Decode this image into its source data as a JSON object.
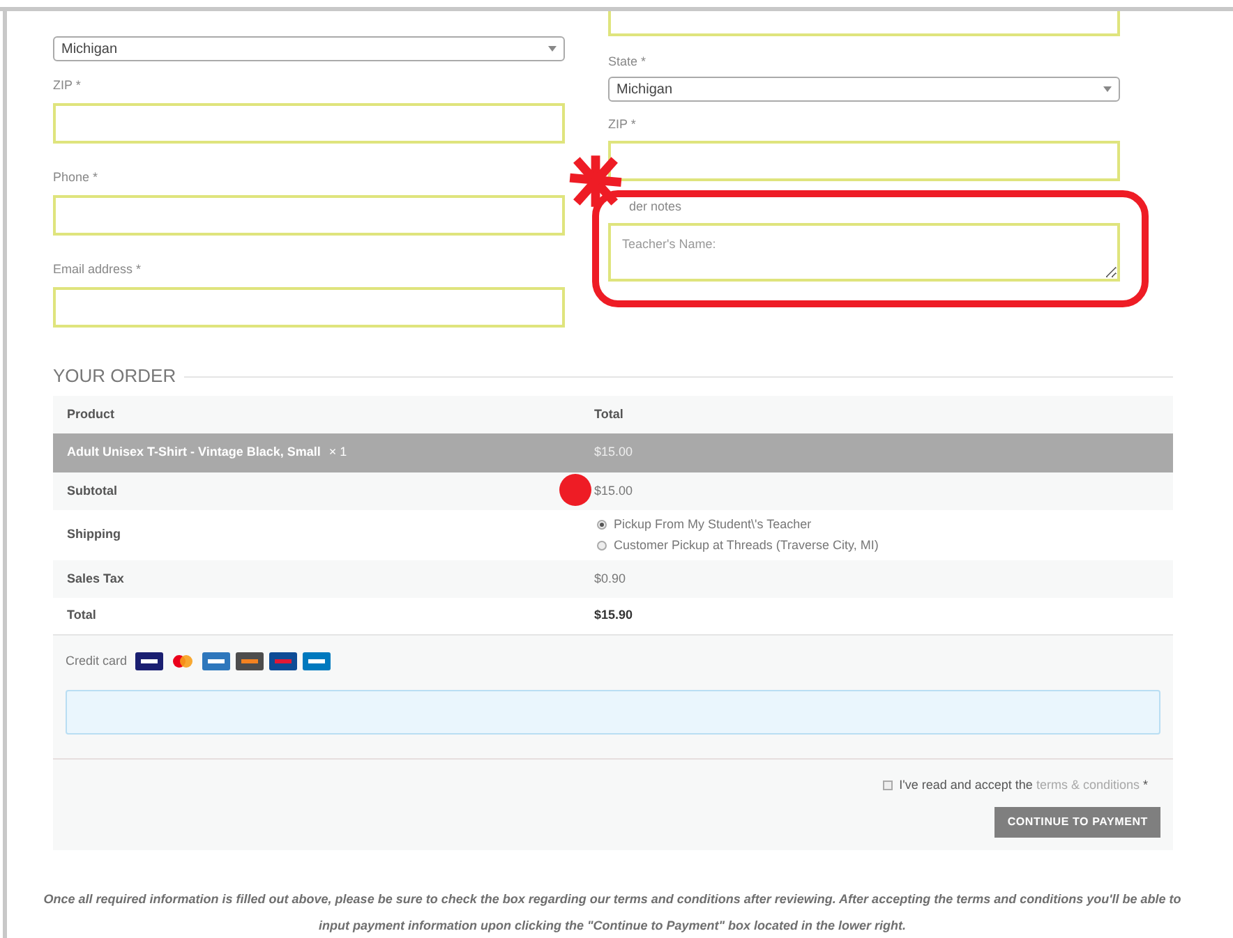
{
  "left_form": {
    "state_select": {
      "value": "Michigan"
    },
    "fields": [
      {
        "label": "ZIP",
        "required_mark": "*"
      },
      {
        "label": "Phone",
        "required_mark": "*"
      },
      {
        "label": "Email address",
        "required_mark": "*"
      }
    ]
  },
  "right_form": {
    "state_label": "State",
    "state_required_mark": "*",
    "state_select": {
      "value": "Michigan"
    },
    "zip_label": "ZIP",
    "zip_required_mark": "*",
    "order_notes_label": "der notes",
    "order_notes": {
      "placeholder": "Teacher's Name:"
    }
  },
  "order": {
    "heading": "YOUR ORDER",
    "columns": [
      "Product",
      "Total"
    ],
    "rows": [
      {
        "kind": "item",
        "label": "Adult Unisex T-Shirt - Vintage Black, Small",
        "quantity": "× 1",
        "value": "$15.00"
      },
      {
        "kind": "plain",
        "label": "Subtotal",
        "value": "$15.00"
      },
      {
        "kind": "shipping",
        "label": "Shipping",
        "options": [
          {
            "label": "Pickup From My Student\\'s Teacher",
            "selected": true
          },
          {
            "label": "Customer Pickup at Threads (Traverse City, MI)",
            "selected": false
          }
        ]
      },
      {
        "kind": "plain",
        "label": "Sales Tax",
        "value": "$0.90"
      },
      {
        "kind": "total",
        "label": "Total",
        "value": "$15.90"
      }
    ]
  },
  "payment": {
    "method_label": "Credit card",
    "terms": {
      "checked": false,
      "text": "I've read and accept the",
      "link": "terms & conditions",
      "required_mark": "*"
    },
    "button": "CONTINUE TO PAYMENT"
  },
  "footnote": "Once all required information is filled out above, please be sure to check the box regarding our terms and conditions after reviewing. After accepting the terms and conditions you'll be able to input payment information upon clicking the \"Continue to Payment\" box located in the lower right."
}
